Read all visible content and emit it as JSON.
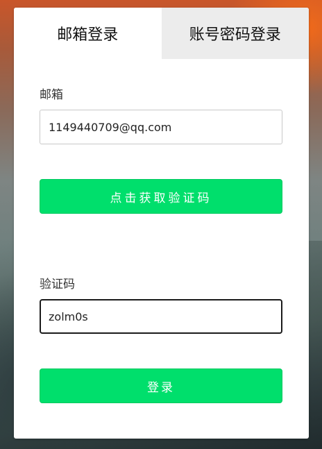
{
  "tabs": [
    {
      "label": "邮箱登录",
      "active": true
    },
    {
      "label": "账号密码登录",
      "active": false
    }
  ],
  "email": {
    "label": "邮箱",
    "value": "1149440709@qq.com"
  },
  "get_code_button": "点击获取验证码",
  "code": {
    "label": "验证码",
    "value": "zolm0s"
  },
  "login_button": "登录",
  "colors": {
    "primary_green": "#00df6c",
    "inactive_tab": "#ececec"
  }
}
